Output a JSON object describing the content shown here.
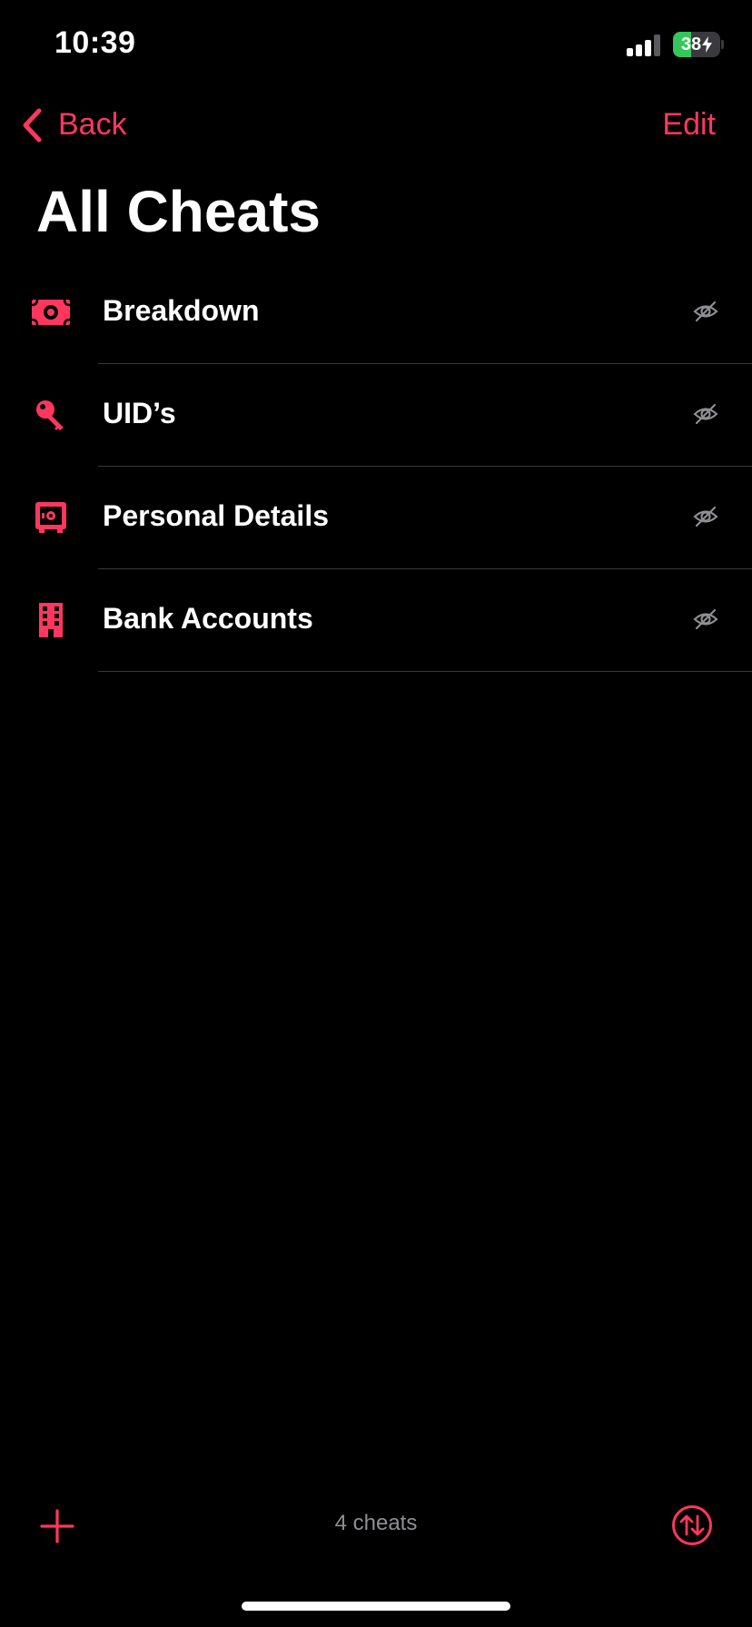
{
  "status_bar": {
    "time": "10:39",
    "battery_percent": "38",
    "battery_level": 0.38,
    "battery_charging": true
  },
  "nav": {
    "back_label": "Back",
    "edit_label": "Edit",
    "title": "All Cheats"
  },
  "list": {
    "items": [
      {
        "label": "Breakdown",
        "icon": "money-bill-icon"
      },
      {
        "label": "UID’s",
        "icon": "key-icon"
      },
      {
        "label": "Personal Details",
        "icon": "safe-icon"
      },
      {
        "label": "Bank Accounts",
        "icon": "building-icon"
      }
    ],
    "item_trailing_icon": "eye-slash-icon"
  },
  "toolbar": {
    "count_label": "4 cheats",
    "add_icon": "plus-icon",
    "sort_icon": "sort-arrows-icon"
  },
  "colors": {
    "accent": "#ff375f",
    "background": "#000000",
    "secondary_text": "#8e8e93",
    "battery_green": "#34c759"
  }
}
